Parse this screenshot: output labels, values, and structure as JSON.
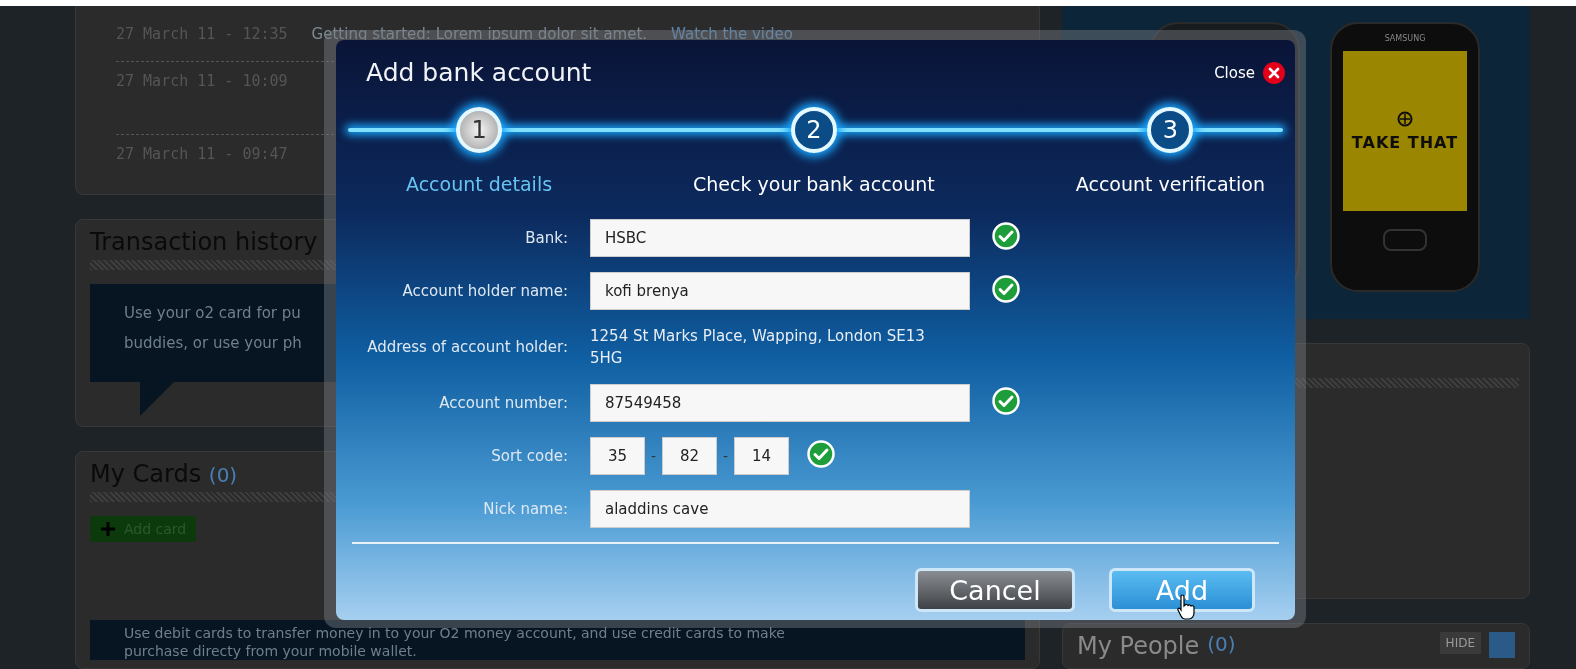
{
  "background": {
    "news": [
      {
        "time": "27 March 11 - 12:35",
        "text": "Getting started: Lorem ipsum dolor sit amet.",
        "link": "Watch the video"
      },
      {
        "time": "27 March 11 - 10:09"
      },
      {
        "time": "27 March 11 - 09:47"
      }
    ],
    "transaction_history": {
      "title": "Transaction history",
      "lines": [
        "Use your o2 card for pu",
        "buddies, or use your ph"
      ]
    },
    "my_cards": {
      "title": "My Cards",
      "count": "(0)",
      "button": "Add card",
      "lines": [
        "Use debit cards to transfer money in to your O2 money account, and use credit cards to make",
        "purchase directy from your mobile wallet."
      ]
    },
    "promo": {
      "brand": "SAMSUNG",
      "screen_text": "TAKE THAT"
    },
    "my_people": {
      "title": "My People",
      "count": "(0)",
      "hide": "HIDE"
    }
  },
  "dialog": {
    "title": "Add bank account",
    "close": "Close",
    "steps": [
      {
        "number": "1",
        "label": "Account details",
        "selected": true
      },
      {
        "number": "2",
        "label": "Check your bank account",
        "selected": false
      },
      {
        "number": "3",
        "label": "Account verification",
        "selected": false
      }
    ],
    "fields": [
      {
        "kind": "text",
        "label": "Bank:",
        "value": "HSBC",
        "valid": true
      },
      {
        "kind": "text",
        "label": "Account holder name:",
        "value": "kofi brenya",
        "valid": true
      },
      {
        "kind": "static",
        "label": "Address of account holder:",
        "value": "1254 St Marks Place, Wapping, London SE13 5HG"
      },
      {
        "kind": "text",
        "label": "Account number:",
        "value": "87549458",
        "valid": true
      },
      {
        "kind": "sort",
        "label": "Sort code:",
        "parts": [
          "35",
          "82",
          "14"
        ],
        "separator": "-",
        "valid": true
      },
      {
        "kind": "text",
        "label": "Nick name:",
        "value": "aladdins cave"
      }
    ],
    "buttons": [
      {
        "kind": "secondary",
        "label": "Cancel"
      },
      {
        "kind": "primary",
        "label": "Add"
      }
    ]
  }
}
